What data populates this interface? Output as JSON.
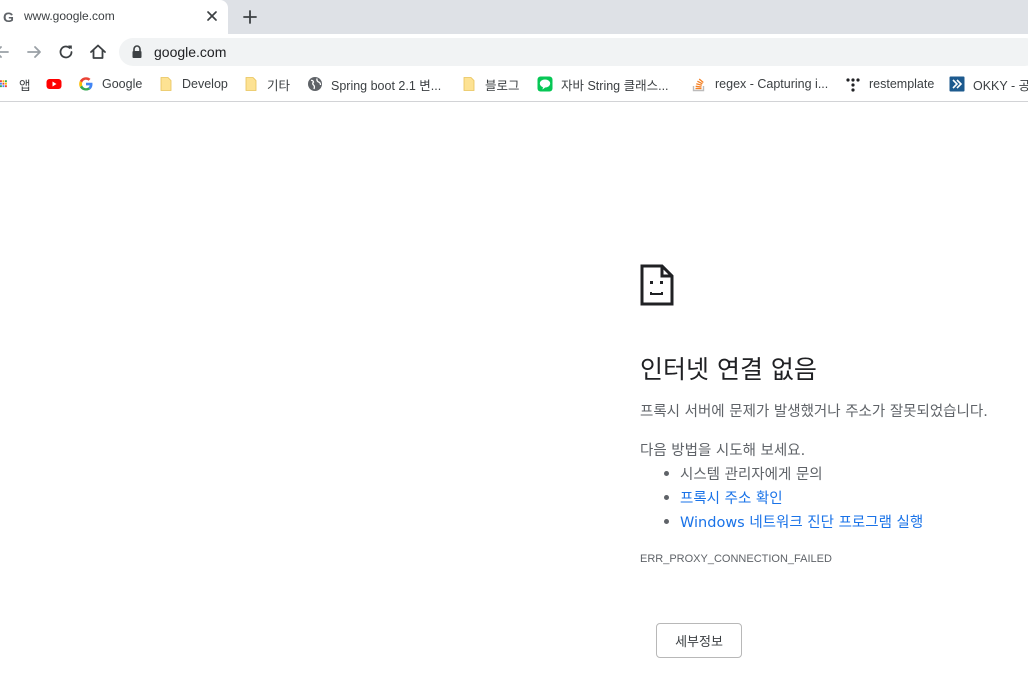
{
  "tab": {
    "favicon": "G",
    "title": "www.google.com",
    "close_icon": "close-icon",
    "new_tab_icon": "plus-icon"
  },
  "toolbar": {
    "url": "google.com",
    "icons": [
      "back-icon",
      "forward-icon",
      "reload-icon",
      "home-icon",
      "lock-icon"
    ]
  },
  "bookmarks": [
    {
      "label": "앱",
      "icon": "apps-grid-icon"
    },
    {
      "label": "",
      "icon": "youtube-icon"
    },
    {
      "label": "Google",
      "icon": "google-icon"
    },
    {
      "label": "Develop",
      "icon": "folder-icon"
    },
    {
      "label": "기타",
      "icon": "folder-icon"
    },
    {
      "label": "Spring boot 2.1 변...",
      "icon": "globe-icon"
    },
    {
      "label": "블로그",
      "icon": "folder-icon"
    },
    {
      "label": "자바 String 클래스...",
      "icon": "line-chat-icon"
    },
    {
      "label": "regex - Capturing i...",
      "icon": "stackoverflow-icon"
    },
    {
      "label": "restemplate",
      "icon": "dots-icon"
    },
    {
      "label": "OKKY - 공",
      "icon": "okky-icon"
    }
  ],
  "error": {
    "icon": "sad-document-icon",
    "heading": "인터넷 연결 없음",
    "description": "프록시 서버에 문제가 발생했거나 주소가 잘못되었습니다.",
    "suggestions_title": "다음 방법을 시도해 보세요.",
    "suggestions": [
      {
        "text": "시스템 관리자에게 문의",
        "link": false
      },
      {
        "text": "프록시 주소 확인",
        "link": true
      },
      {
        "text": "Windows 네트워크 진단 프로그램 실행",
        "link": true
      }
    ],
    "code": "ERR_PROXY_CONNECTION_FAILED",
    "details_button": "세부정보"
  },
  "colors": {
    "link": "#1a73e8",
    "text_secondary": "#5f6368",
    "tabstrip": "#dee1e6",
    "omnibox": "#f1f3f4"
  }
}
